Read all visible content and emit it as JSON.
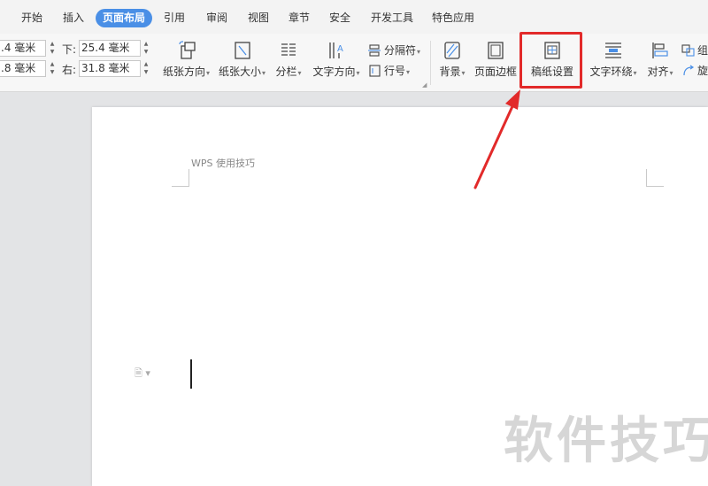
{
  "tabs": [
    {
      "label": "开始"
    },
    {
      "label": "插入"
    },
    {
      "label": "页面布局",
      "active": true
    },
    {
      "label": "引用"
    },
    {
      "label": "审阅"
    },
    {
      "label": "视图"
    },
    {
      "label": "章节"
    },
    {
      "label": "安全"
    },
    {
      "label": "开发工具"
    },
    {
      "label": "特色应用"
    }
  ],
  "margins": {
    "top_value": ".4 毫米",
    "left_value": ".8 毫米",
    "bottom_label": "下:",
    "bottom_value": "25.4 毫米",
    "right_label": "右:",
    "right_value": "31.8 毫米"
  },
  "ribbon": {
    "orientation_label": "纸张方向",
    "size_label": "纸张大小",
    "columns_label": "分栏",
    "text_direction_label": "文字方向",
    "breaks_label": "分隔符",
    "line_numbers_label": "行号",
    "background_label": "背景",
    "page_border_label": "页面边框",
    "manuscript_label": "稿纸设置",
    "wrap_label": "文字环绕",
    "align_label": "对齐",
    "group_label": "组",
    "rotate_label": "旋"
  },
  "document": {
    "header_text": "WPS 使用技巧",
    "watermark": "软件技巧"
  },
  "colors": {
    "active_tab": "#4a8fe6",
    "highlight": "#e22a2a"
  }
}
